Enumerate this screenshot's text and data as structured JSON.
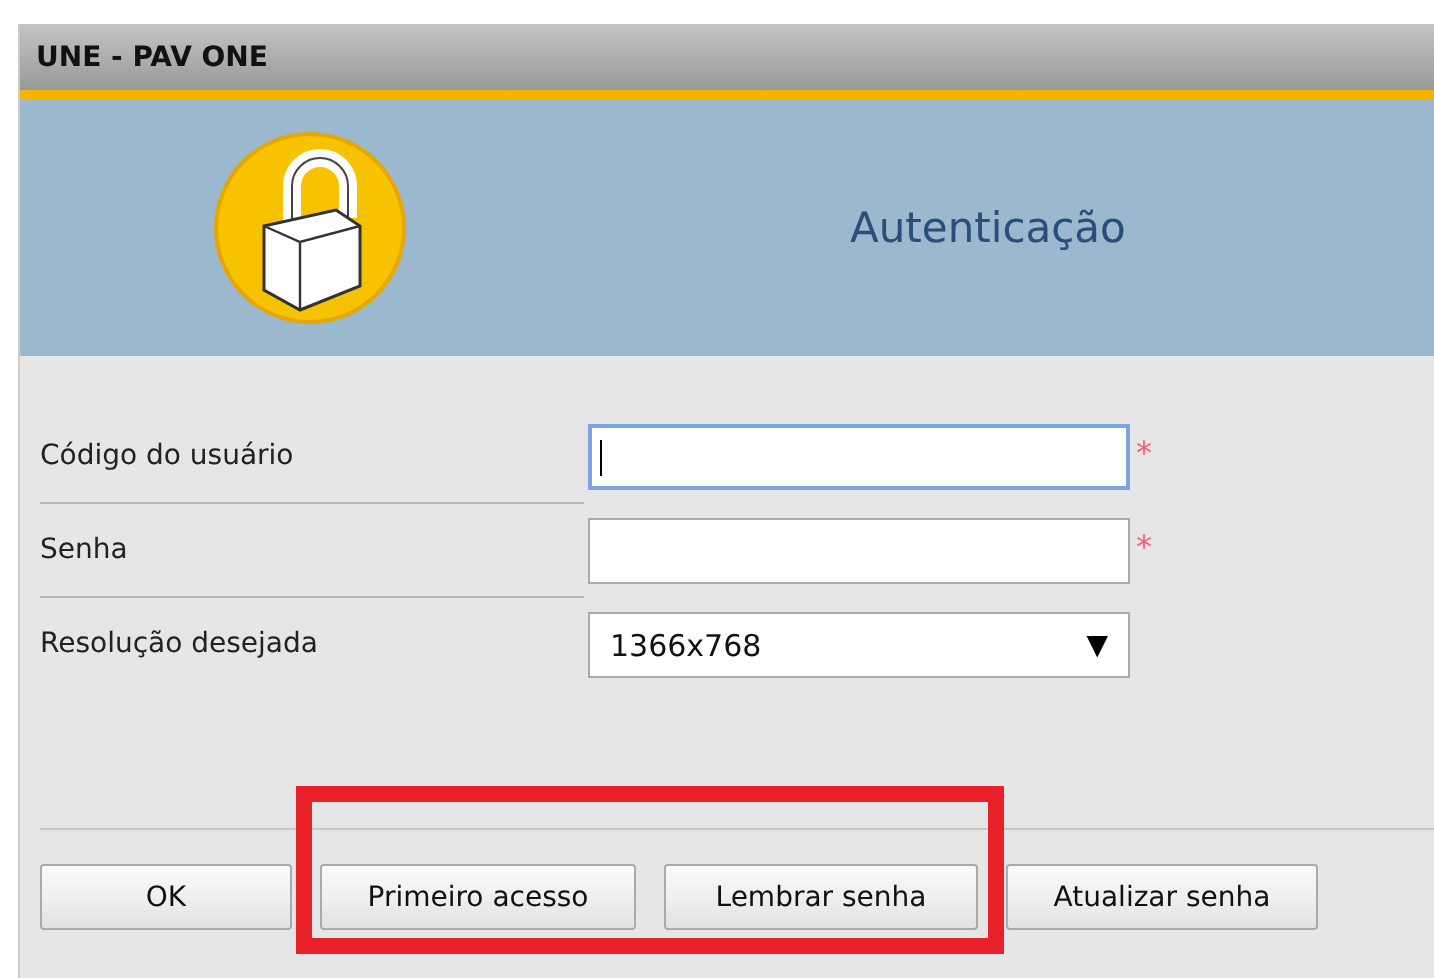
{
  "window": {
    "title": "UNE - PAV ONE"
  },
  "header": {
    "title": "Autenticação"
  },
  "fields": [
    {
      "kind": "text",
      "label": "Código do usuário",
      "focused": true,
      "required_mark": "*"
    },
    {
      "kind": "password",
      "label": "Senha",
      "focused": false,
      "required_mark": "*"
    },
    {
      "kind": "select",
      "label": "Resolução desejada",
      "value": "1366x768",
      "caret": "▼"
    }
  ],
  "buttons": [
    {
      "label": "OK"
    },
    {
      "label": "Primeiro acesso"
    },
    {
      "label": "Lembrar senha"
    },
    {
      "label": "Atualizar senha"
    }
  ]
}
